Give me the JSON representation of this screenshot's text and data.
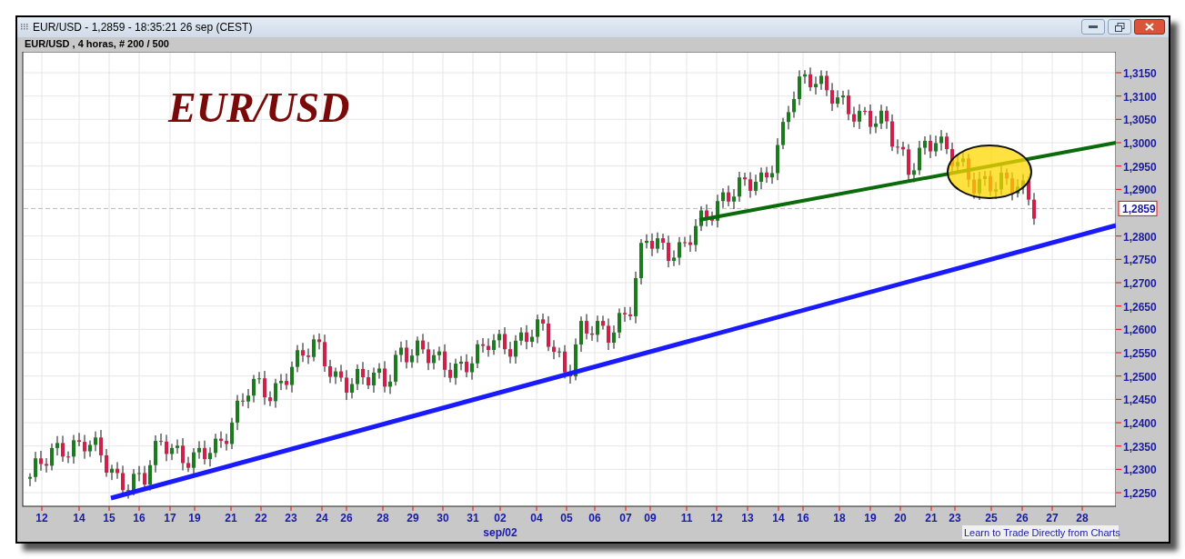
{
  "window": {
    "title": "EUR/USD - 1,2859 - 18:35:21  26 sep (CEST)"
  },
  "chart_header": "EUR/USD , 4 horas, # 200 / 500",
  "chart": {
    "title": "EUR/USD",
    "y_ticks": [
      "1,3150",
      "1,3100",
      "1,3050",
      "1,3000",
      "1,2950",
      "1,2900",
      "1,2800",
      "1,2750",
      "1,2700",
      "1,2650",
      "1,2600",
      "1,2550",
      "1,2500",
      "1,2450",
      "1,2400",
      "1,2350",
      "1,2300",
      "1,2250"
    ],
    "x_labels": [
      "12",
      "14",
      "15",
      "16",
      "17",
      "19",
      "21",
      "22",
      "23",
      "24",
      "26",
      "28",
      "29",
      "30",
      "31",
      "02",
      "04",
      "05",
      "06",
      "07",
      "09",
      "11",
      "12",
      "13",
      "14",
      "16",
      "18",
      "19",
      "20",
      "21",
      "23",
      "25",
      "26",
      "27",
      "28"
    ],
    "month_label": "sep/02",
    "current_price": "1,2859"
  },
  "footer_link": "Learn to Trade Directly from Charts"
}
